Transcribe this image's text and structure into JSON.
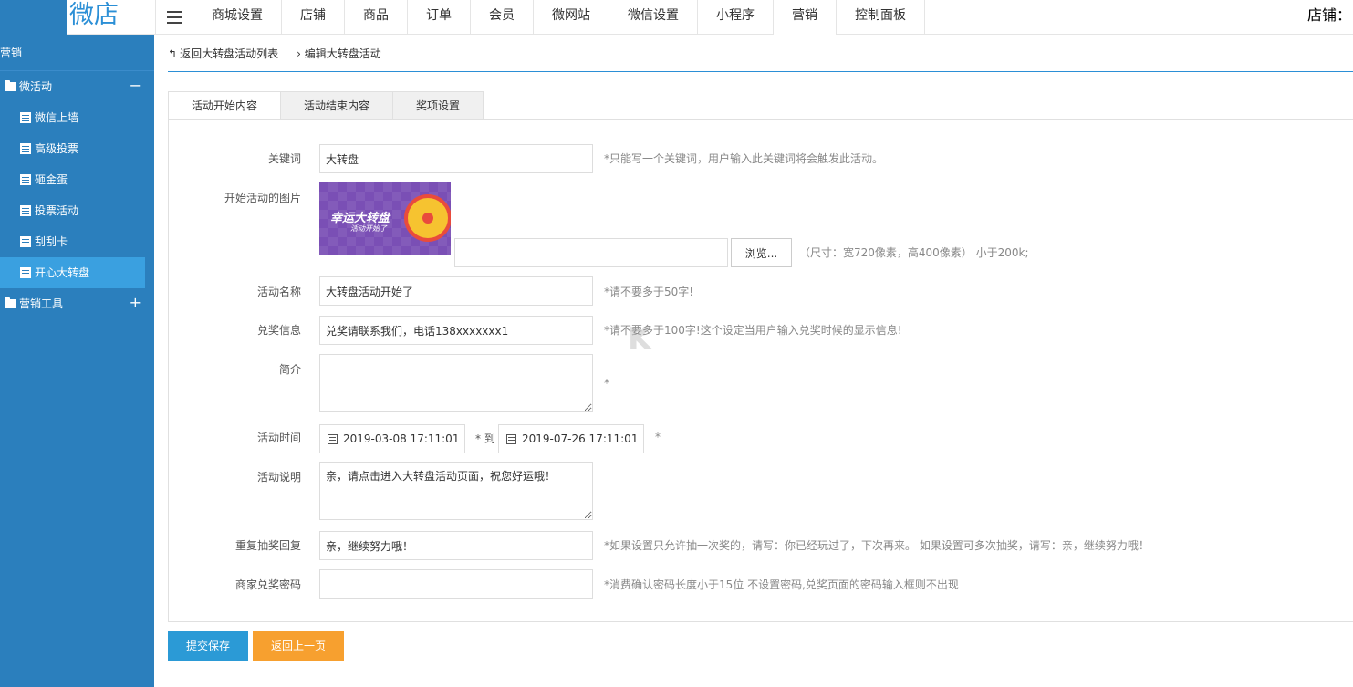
{
  "header": {
    "logo_text": "微店",
    "nav": [
      "商城设置",
      "店铺",
      "商品",
      "订单",
      "会员",
      "微网站",
      "微信设置",
      "小程序",
      "营销",
      "控制面板"
    ],
    "shop_label": "店铺："
  },
  "sidebar": {
    "title": "营销",
    "group1": {
      "label": "微活动",
      "toggle": "−"
    },
    "items": [
      "微信上墙",
      "高级投票",
      "砸金蛋",
      "投票活动",
      "刮刮卡",
      "开心大转盘"
    ],
    "group2": {
      "label": "营销工具",
      "toggle": "+"
    }
  },
  "breadcrumb": {
    "back": "返回大转盘活动列表",
    "current": "编辑大转盘活动"
  },
  "tabs": [
    "活动开始内容",
    "活动结束内容",
    "奖项设置"
  ],
  "form": {
    "keyword": {
      "label": "关键词",
      "value": "大转盘",
      "hint": "*只能写一个关键词，用户输入此关键词将会触发此活动。"
    },
    "image": {
      "label": "开始活动的图片",
      "preview_title": "幸运大转盘",
      "preview_sub": "活动开始了",
      "browse": "浏览...",
      "hint": "（尺寸：宽720像素，高400像素） 小于200k;"
    },
    "name": {
      "label": "活动名称",
      "value": "大转盘活动开始了",
      "hint": "*请不要多于50字!"
    },
    "prize_info": {
      "label": "兑奖信息",
      "value": "兑奖请联系我们，电话138xxxxxxx1",
      "hint": "*请不要多于100字!这个设定当用户输入兑奖时候的显示信息!"
    },
    "intro": {
      "label": "简介",
      "value": "",
      "hint": "*"
    },
    "time": {
      "label": "活动时间",
      "start": "2019-03-08 17:11:01",
      "sep": "* 到",
      "end": "2019-07-26 17:11:01",
      "hint": "*"
    },
    "description": {
      "label": "活动说明",
      "value": "亲，请点击进入大转盘活动页面，祝您好运哦！"
    },
    "repeat_reply": {
      "label": "重复抽奖回复",
      "value": "亲，继续努力哦！",
      "hint": "*如果设置只允许抽一次奖的，请写：你已经玩过了，下次再来。 如果设置可多次抽奖，请写：亲，继续努力哦！"
    },
    "password": {
      "label": "商家兑奖密码",
      "value": "",
      "hint": "*消费确认密码长度小于15位 不设置密码,兑奖页面的密码输入框则不出现"
    }
  },
  "buttons": {
    "submit": "提交保存",
    "back": "返回上一页"
  },
  "watermark": "K"
}
